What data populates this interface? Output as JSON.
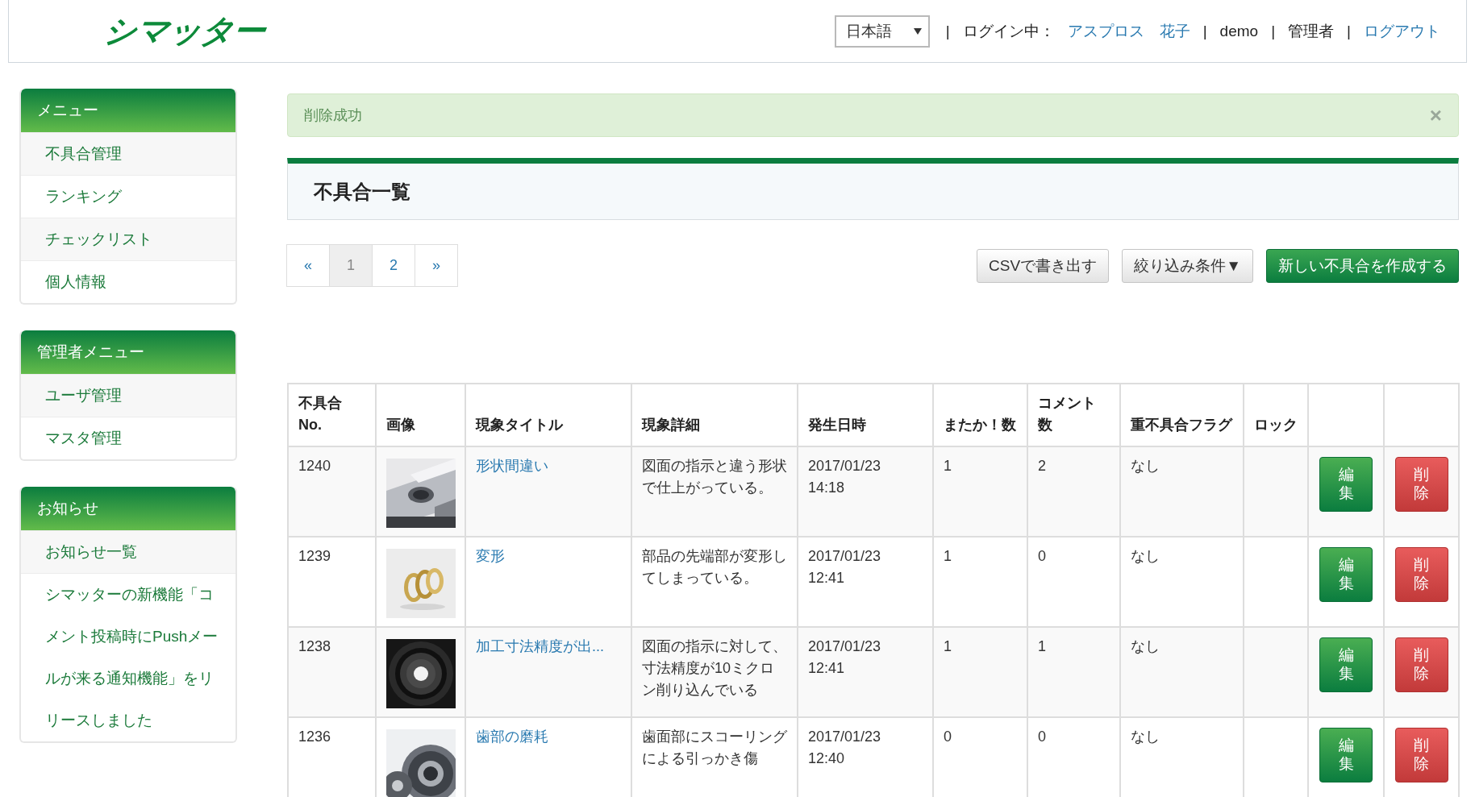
{
  "header": {
    "logo": "シマッター",
    "language": "日本語",
    "nav": [
      {
        "kind": "text",
        "text": "|"
      },
      {
        "kind": "text",
        "text": "ログイン中："
      },
      {
        "kind": "link",
        "text": "アスプロス　花子"
      },
      {
        "kind": "text",
        "text": "|"
      },
      {
        "kind": "text",
        "text": "demo"
      },
      {
        "kind": "text",
        "text": "|"
      },
      {
        "kind": "text",
        "text": "管理者"
      },
      {
        "kind": "text",
        "text": "|"
      },
      {
        "kind": "link",
        "text": "ログアウト"
      }
    ]
  },
  "sidebar": {
    "panels": [
      {
        "title": "メニュー",
        "items": [
          "不具合管理",
          "ランキング",
          "チェックリスト",
          "個人情報"
        ]
      },
      {
        "title": "管理者メニュー",
        "items": [
          "ユーザ管理",
          "マスタ管理"
        ]
      },
      {
        "title": "お知らせ",
        "items": [
          "お知らせ一覧",
          "シマッターの新機能「コメント投稿時にPushメールが来る通知機能」をリリースしました"
        ]
      }
    ]
  },
  "alert": {
    "message": "削除成功",
    "close": "×"
  },
  "page_title": "不具合一覧",
  "pagination": [
    {
      "label": "«",
      "selected": false
    },
    {
      "label": "1",
      "selected": true
    },
    {
      "label": "2",
      "selected": false
    },
    {
      "label": "»",
      "selected": false
    }
  ],
  "actions": [
    {
      "kind": "default",
      "label": "CSVで書き出す"
    },
    {
      "kind": "default",
      "label": "絞り込み条件▼"
    },
    {
      "kind": "primary",
      "label": "新しい不具合を作成する"
    }
  ],
  "table": {
    "columns": [
      "不具合 No.",
      "画像",
      "現象タイトル",
      "現象詳細",
      "発生日時",
      "またか！数",
      "コメント数",
      "重不具合フラグ",
      "ロック"
    ],
    "rows": [
      {
        "no": "1240",
        "title": "形状間違い",
        "detail": "図面の指示と違う形状で仕上がっている。",
        "date": "2017/01/23",
        "time": "14:18",
        "repeat": "1",
        "comments": "2",
        "flag": "なし",
        "edit": "編集",
        "delete": "削除"
      },
      {
        "no": "1239",
        "title": "変形",
        "detail": "部品の先端部が変形してしまっている。",
        "date": "2017/01/23",
        "time": "12:41",
        "repeat": "1",
        "comments": "0",
        "flag": "なし",
        "edit": "編集",
        "delete": "削除"
      },
      {
        "no": "1238",
        "title": "加工寸法精度が出...",
        "detail": "図面の指示に対して、寸法精度が10ミクロン削り込んでいる",
        "date": "2017/01/23",
        "time": "12:41",
        "repeat": "1",
        "comments": "1",
        "flag": "なし",
        "edit": "編集",
        "delete": "削除"
      },
      {
        "no": "1236",
        "title": "歯部の磨耗",
        "detail": "歯面部にスコーリングによる引っかき傷",
        "date": "2017/01/23",
        "time": "12:40",
        "repeat": "0",
        "comments": "0",
        "flag": "なし",
        "edit": "編集",
        "delete": "削除"
      }
    ]
  }
}
